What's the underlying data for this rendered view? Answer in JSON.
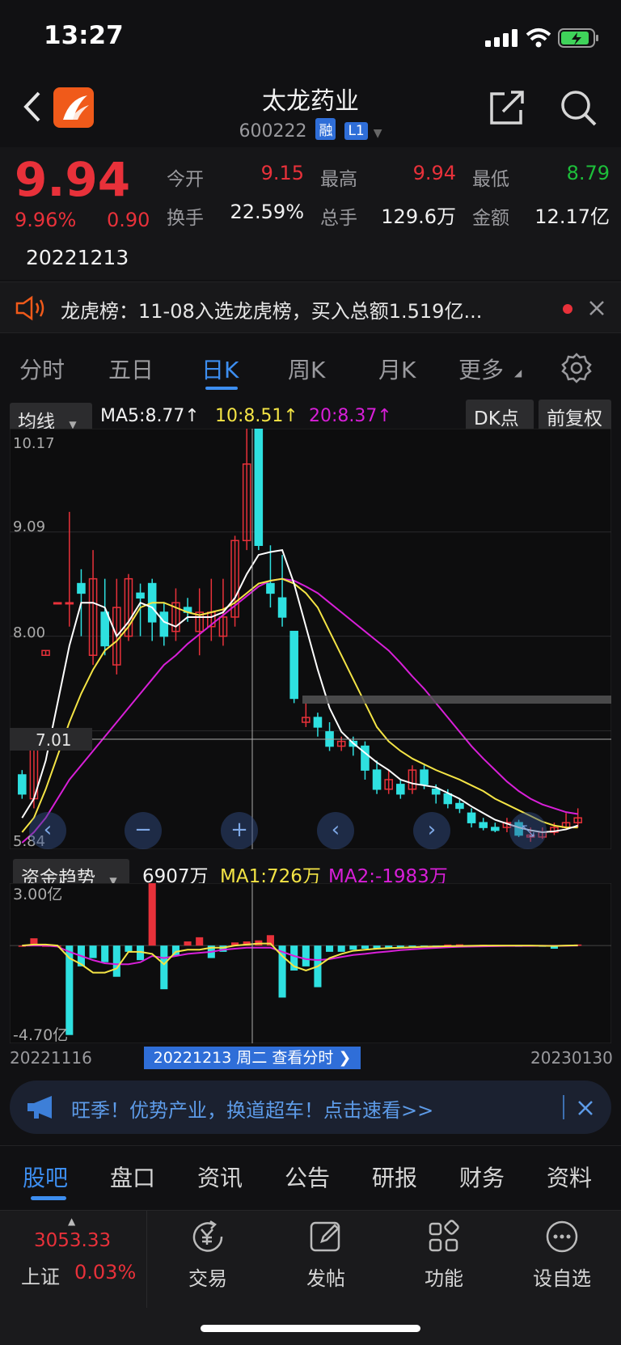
{
  "status": {
    "time": "13:27"
  },
  "header": {
    "title": "太龙药业",
    "code": "600222",
    "tag_margin": "融",
    "tag_level": "L1"
  },
  "quote": {
    "price": "9.94",
    "change_pct": "9.96%",
    "change": "0.90",
    "date": "20221213",
    "open_label": "今开",
    "open": "9.15",
    "high_label": "最高",
    "high": "9.94",
    "low_label": "最低",
    "low": "8.79",
    "turnover_label": "换手",
    "turnover": "22.59%",
    "volume_label": "总手",
    "volume": "129.6万",
    "amount_label": "金额",
    "amount": "12.17亿"
  },
  "notice": {
    "text": "龙虎榜：11-08入选龙虎榜，买入总额1.519亿..."
  },
  "period_tabs": [
    "分时",
    "五日",
    "日K",
    "周K",
    "月K",
    "更多"
  ],
  "active_period": "日K",
  "kchart": {
    "ma_selector": "均线",
    "ma5": "MA5:8.77↑",
    "ma10": "10:8.51↑",
    "ma20": "20:8.37↑",
    "dk_label": "DK点",
    "adjust_label": "前复权",
    "cursor_price": "7.01"
  },
  "fund": {
    "selector": "资金趋势",
    "value": "6907万",
    "ma1": "MA1:726万",
    "ma2": "MA2:-1983万"
  },
  "dates": {
    "start": "20221116",
    "end": "20230130",
    "cursor": "20221213 周二 查看分时 ❯"
  },
  "ad": {
    "text": "旺季！优势产业，换道超车！点击速看>>"
  },
  "bottom_tabs": [
    "股吧",
    "盘口",
    "资讯",
    "公告",
    "研报",
    "财务",
    "资料"
  ],
  "active_bottom": "股吧",
  "toolbar": {
    "index_value": "3053.33",
    "index_name": "上证",
    "index_pct": "0.03%",
    "trade": "交易",
    "post": "发帖",
    "functions": "功能",
    "watchlist": "设自选"
  },
  "colors": {
    "up": "#e8313a",
    "down": "#2ee0e0",
    "ma5": "#ffffff",
    "ma10": "#f4e445",
    "ma20": "#d81fd8",
    "accent": "#3d8ef0"
  },
  "chart_data": [
    {
      "type": "candlestick",
      "ylim": [
        5.84,
        10.17
      ],
      "ytick_labels": [
        "10.17",
        "9.09",
        "8.00",
        "5.84"
      ],
      "x_labels": [
        "20221116",
        "20230130"
      ],
      "candles": [
        {
          "o": 6.55,
          "c": 6.35,
          "h": 6.6,
          "l": 6.3
        },
        {
          "o": 6.3,
          "c": 6.95,
          "h": 7.0,
          "l": 6.2
        },
        {
          "o": 7.8,
          "c": 7.85,
          "h": 7.85,
          "l": 7.8
        },
        {
          "o": 8.35,
          "c": 8.35,
          "h": 8.35,
          "l": 8.35
        },
        {
          "o": 8.35,
          "c": 8.35,
          "h": 9.3,
          "l": 8.1
        },
        {
          "o": 8.55,
          "c": 8.45,
          "h": 8.7,
          "l": 8.0
        },
        {
          "o": 7.8,
          "c": 8.6,
          "h": 8.9,
          "l": 7.7
        },
        {
          "o": 8.25,
          "c": 7.9,
          "h": 8.6,
          "l": 7.8
        },
        {
          "o": 7.7,
          "c": 8.3,
          "h": 8.6,
          "l": 7.6
        },
        {
          "o": 8.0,
          "c": 8.6,
          "h": 8.65,
          "l": 7.95
        },
        {
          "o": 8.45,
          "c": 8.4,
          "h": 8.55,
          "l": 8.0
        },
        {
          "o": 8.55,
          "c": 8.15,
          "h": 8.6,
          "l": 7.95
        },
        {
          "o": 8.25,
          "c": 8.0,
          "h": 8.35,
          "l": 7.9
        },
        {
          "o": 8.05,
          "c": 8.35,
          "h": 8.5,
          "l": 7.95
        },
        {
          "o": 8.3,
          "c": 8.25,
          "h": 8.4,
          "l": 8.15
        },
        {
          "o": 8.05,
          "c": 8.25,
          "h": 8.5,
          "l": 7.8
        },
        {
          "o": 8.1,
          "c": 8.25,
          "h": 8.6,
          "l": 7.95
        },
        {
          "o": 8.0,
          "c": 8.2,
          "h": 8.6,
          "l": 7.9
        },
        {
          "o": 8.2,
          "c": 9.0,
          "h": 9.05,
          "l": 8.1
        },
        {
          "o": 9.0,
          "c": 9.8,
          "h": 10.17,
          "l": 8.9
        },
        {
          "o": 10.17,
          "c": 8.95,
          "h": 10.17,
          "l": 8.9
        },
        {
          "o": 8.55,
          "c": 8.45,
          "h": 8.95,
          "l": 8.3
        },
        {
          "o": 8.4,
          "c": 8.2,
          "h": 8.85,
          "l": 8.1
        },
        {
          "o": 8.05,
          "c": 7.35,
          "h": 8.05,
          "l": 7.3
        },
        {
          "o": 7.1,
          "c": 7.15,
          "h": 7.3,
          "l": 7.05
        },
        {
          "o": 7.15,
          "c": 7.05,
          "h": 7.2,
          "l": 6.95
        },
        {
          "o": 7.0,
          "c": 6.85,
          "h": 7.1,
          "l": 6.8
        },
        {
          "o": 6.85,
          "c": 6.9,
          "h": 6.95,
          "l": 6.8
        },
        {
          "o": 6.9,
          "c": 6.85,
          "h": 6.95,
          "l": 6.75
        },
        {
          "o": 6.85,
          "c": 6.6,
          "h": 6.9,
          "l": 6.5
        },
        {
          "o": 6.6,
          "c": 6.4,
          "h": 6.7,
          "l": 6.35
        },
        {
          "o": 6.4,
          "c": 6.5,
          "h": 6.6,
          "l": 6.35
        },
        {
          "o": 6.45,
          "c": 6.35,
          "h": 6.5,
          "l": 6.3
        },
        {
          "o": 6.4,
          "c": 6.6,
          "h": 6.65,
          "l": 6.35
        },
        {
          "o": 6.6,
          "c": 6.45,
          "h": 6.65,
          "l": 6.4
        },
        {
          "o": 6.4,
          "c": 6.35,
          "h": 6.45,
          "l": 6.25
        },
        {
          "o": 6.35,
          "c": 6.25,
          "h": 6.4,
          "l": 6.2
        },
        {
          "o": 6.25,
          "c": 6.2,
          "h": 6.3,
          "l": 6.15
        },
        {
          "o": 6.15,
          "c": 6.05,
          "h": 6.2,
          "l": 6.0
        },
        {
          "o": 6.05,
          "c": 6.0,
          "h": 6.1,
          "l": 5.97
        },
        {
          "o": 6.0,
          "c": 5.97,
          "h": 6.05,
          "l": 5.95
        },
        {
          "o": 6.0,
          "c": 6.05,
          "h": 6.1,
          "l": 5.95
        },
        {
          "o": 6.05,
          "c": 5.92,
          "h": 6.08,
          "l": 5.9
        },
        {
          "o": 5.9,
          "c": 5.92,
          "h": 6.0,
          "l": 5.85
        },
        {
          "o": 5.9,
          "c": 5.95,
          "h": 6.0,
          "l": 5.88
        },
        {
          "o": 5.95,
          "c": 6.0,
          "h": 6.05,
          "l": 5.92
        },
        {
          "o": 6.0,
          "c": 6.05,
          "h": 6.15,
          "l": 5.98
        },
        {
          "o": 6.05,
          "c": 6.1,
          "h": 6.2,
          "l": 6.0
        }
      ],
      "ma5": [
        6.1,
        6.3,
        6.7,
        7.3,
        7.9,
        8.35,
        8.35,
        8.3,
        8.0,
        8.15,
        8.35,
        8.3,
        8.15,
        8.1,
        8.2,
        8.2,
        8.2,
        8.25,
        8.4,
        8.65,
        8.85,
        8.88,
        8.9,
        8.55,
        8.1,
        7.65,
        7.25,
        7.0,
        6.88,
        6.78,
        6.68,
        6.6,
        6.5,
        6.46,
        6.44,
        6.42,
        6.36,
        6.3,
        6.22,
        6.15,
        6.08,
        6.04,
        6.0,
        5.97,
        5.95,
        5.96,
        5.98,
        6.02
      ],
      "ma10": [
        5.95,
        6.1,
        6.4,
        6.75,
        7.1,
        7.4,
        7.65,
        7.85,
        7.95,
        8.1,
        8.3,
        8.35,
        8.35,
        8.3,
        8.25,
        8.22,
        8.25,
        8.28,
        8.35,
        8.45,
        8.55,
        8.58,
        8.6,
        8.55,
        8.45,
        8.3,
        8.05,
        7.8,
        7.55,
        7.3,
        7.05,
        6.9,
        6.8,
        6.72,
        6.66,
        6.6,
        6.55,
        6.5,
        6.44,
        6.38,
        6.3,
        6.24,
        6.18,
        6.12,
        6.06,
        6.02,
        6.0,
        6.0
      ],
      "ma20": [
        5.84,
        5.95,
        6.1,
        6.3,
        6.5,
        6.65,
        6.8,
        6.95,
        7.1,
        7.25,
        7.4,
        7.55,
        7.7,
        7.8,
        7.92,
        8.02,
        8.12,
        8.22,
        8.32,
        8.42,
        8.52,
        8.58,
        8.6,
        8.58,
        8.52,
        8.45,
        8.35,
        8.25,
        8.15,
        8.05,
        7.95,
        7.85,
        7.72,
        7.58,
        7.45,
        7.3,
        7.15,
        7.0,
        6.85,
        6.72,
        6.6,
        6.48,
        6.38,
        6.3,
        6.24,
        6.2,
        6.16,
        6.14
      ]
    },
    {
      "type": "bar",
      "ylim": [
        -4.7,
        3.0
      ],
      "ytick_labels": [
        "3.00亿",
        "-4.70亿"
      ],
      "values": [
        0,
        0.35,
        0,
        0,
        -4.3,
        -1.0,
        -0.6,
        -0.8,
        -1.5,
        -0.3,
        -0.7,
        3.0,
        -2.1,
        -0.5,
        0.2,
        0.4,
        -0.6,
        -0.3,
        0.15,
        0.2,
        0.25,
        0.5,
        -2.5,
        -1.2,
        -1.0,
        -2.0,
        -0.3,
        -0.3,
        -0.2,
        -0.15,
        -0.15,
        -0.1,
        -0.1,
        -0.1,
        -0.08,
        -0.08,
        0.05,
        0.06,
        -0.05,
        0.04,
        0.03,
        0.02,
        -0.04,
        0.02,
        -0.01,
        -0.15,
        0.02,
        0.05
      ],
      "ma1": [
        0,
        0.05,
        0.05,
        0,
        -0.6,
        -0.9,
        -1.3,
        -1.3,
        -1.1,
        -0.3,
        -0.3,
        -0.4,
        -0.9,
        -0.3,
        -0.2,
        -0.2,
        -0.1,
        -0.1,
        0,
        0.05,
        0.1,
        0.1,
        -0.5,
        -1.0,
        -1.2,
        -1.0,
        -0.6,
        -0.4,
        -0.25,
        -0.2,
        -0.15,
        -0.12,
        -0.1,
        -0.08,
        -0.06,
        -0.05,
        -0.03,
        -0.02,
        -0.01,
        0,
        0,
        0,
        0,
        0,
        -0.01,
        -0.02,
        0,
        0.01
      ],
      "ma2": [
        0,
        0,
        0,
        -0.05,
        -0.3,
        -0.5,
        -0.7,
        -0.85,
        -0.9,
        -0.9,
        -0.8,
        -0.5,
        -0.6,
        -0.5,
        -0.4,
        -0.35,
        -0.3,
        -0.2,
        -0.15,
        -0.1,
        -0.1,
        -0.1,
        -0.3,
        -0.5,
        -0.65,
        -0.7,
        -0.65,
        -0.55,
        -0.45,
        -0.4,
        -0.33,
        -0.28,
        -0.22,
        -0.18,
        -0.14,
        -0.11,
        -0.08,
        -0.06,
        -0.05,
        -0.04,
        -0.03,
        -0.02,
        -0.02,
        -0.02,
        -0.01,
        -0.01,
        -0.01,
        0
      ]
    }
  ]
}
